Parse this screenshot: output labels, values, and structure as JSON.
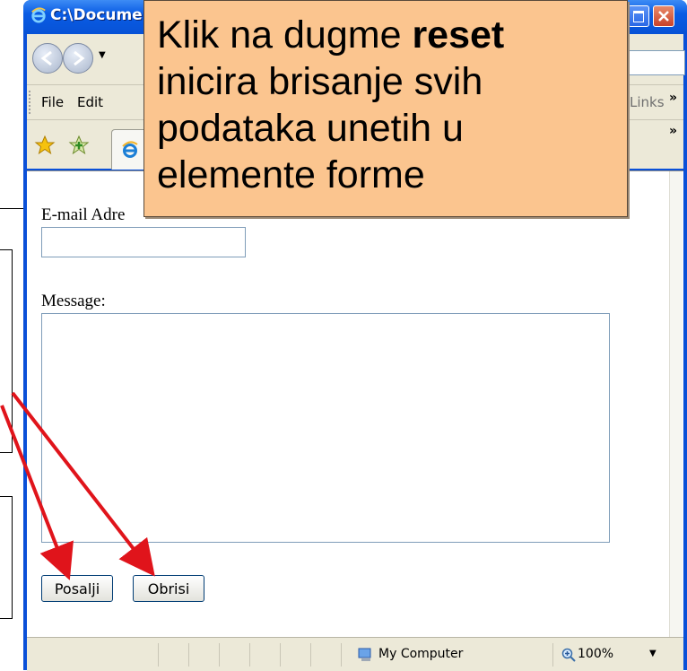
{
  "window": {
    "title": "C:\\Docume",
    "links_label": "Links",
    "overflow": "»"
  },
  "menu": {
    "items": [
      {
        "label": "File"
      },
      {
        "label": "Edit"
      }
    ]
  },
  "form": {
    "email_label": "E-mail Adre",
    "email_value": "",
    "message_label": "Message:",
    "message_value": "",
    "submit_label": "Posalji",
    "reset_label": "Obrisi"
  },
  "status": {
    "zone": "My Computer",
    "zoom": "100%"
  },
  "callout": {
    "text_before": "Klik na dugme ",
    "bold_word": "reset",
    "text_after": " inicira brisanje svih podataka unetih u elemente forme"
  },
  "colors": {
    "callout_bg": "#fbc58f",
    "arrow": "#e0141b",
    "titlebar": "#0a5ce4"
  }
}
